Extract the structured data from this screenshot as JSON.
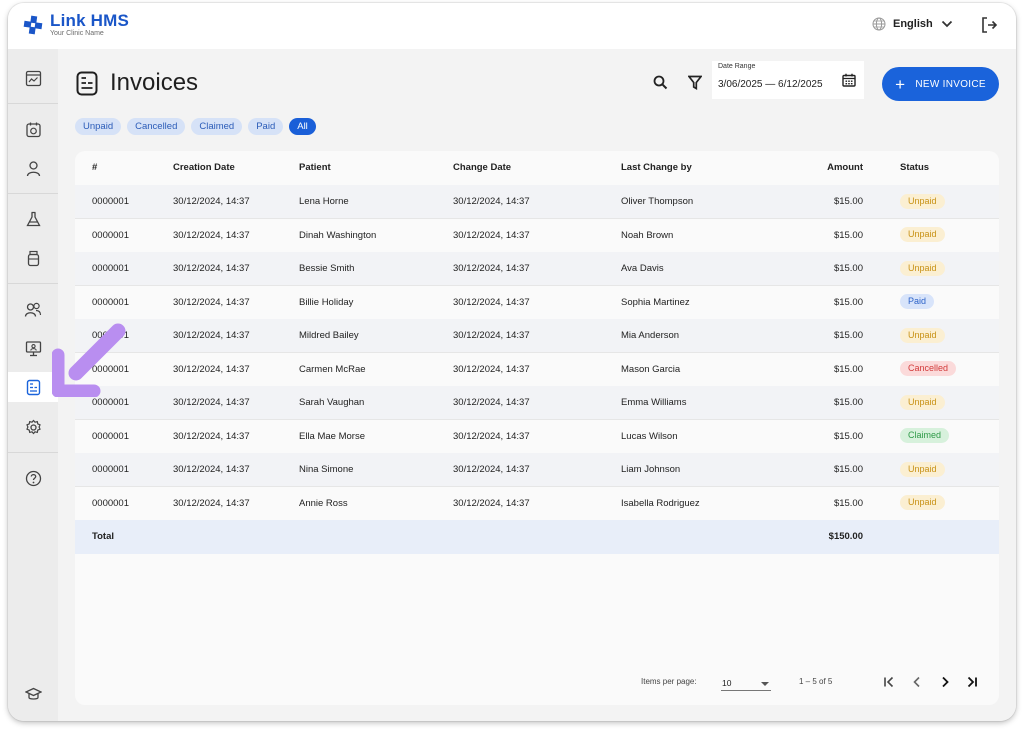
{
  "app": {
    "name": "Link HMS",
    "subtitle": "Your Clinic Name",
    "brand_color": "#1a56c8"
  },
  "header": {
    "language": "English",
    "language_icon": "globe-icon",
    "logout_icon": "logout-icon"
  },
  "sidebar": {
    "items": [
      {
        "icon": "dashboard-icon",
        "active": false
      },
      {
        "icon": "appointments-icon",
        "active": false
      },
      {
        "icon": "patients-icon",
        "active": false
      },
      {
        "icon": "lab-icon",
        "active": false
      },
      {
        "icon": "medication-icon",
        "active": false
      },
      {
        "icon": "staff-icon",
        "active": false
      },
      {
        "icon": "monitor-icon",
        "active": false
      },
      {
        "icon": "invoices-icon",
        "active": true
      },
      {
        "icon": "settings-icon",
        "active": false
      },
      {
        "icon": "help-icon",
        "active": false
      },
      {
        "icon": "education-icon",
        "active": false
      }
    ]
  },
  "page": {
    "title": "Invoices",
    "date_range_label": "Date Range",
    "date_range_value": "3/06/2025 — 6/12/2025",
    "new_button": "NEW INVOICE"
  },
  "filters": [
    {
      "label": "Unpaid",
      "active": false
    },
    {
      "label": "Cancelled",
      "active": false
    },
    {
      "label": "Claimed",
      "active": false
    },
    {
      "label": "Paid",
      "active": false
    },
    {
      "label": "All",
      "active": true
    }
  ],
  "table": {
    "columns": [
      "#",
      "Creation Date",
      "Patient",
      "Change Date",
      "Last Change by",
      "Amount",
      "Status"
    ],
    "rows": [
      {
        "id": "0000001",
        "created": "30/12/2024, 14:37",
        "patient": "Lena Horne",
        "changed": "30/12/2024, 14:37",
        "by": "Oliver Thompson",
        "amount": "$15.00",
        "status": "Unpaid"
      },
      {
        "id": "0000001",
        "created": "30/12/2024, 14:37",
        "patient": "Dinah Washington",
        "changed": "30/12/2024, 14:37",
        "by": "Noah Brown",
        "amount": "$15.00",
        "status": "Unpaid"
      },
      {
        "id": "0000001",
        "created": "30/12/2024, 14:37",
        "patient": "Bessie Smith",
        "changed": "30/12/2024, 14:37",
        "by": "Ava Davis",
        "amount": "$15.00",
        "status": "Unpaid"
      },
      {
        "id": "0000001",
        "created": "30/12/2024, 14:37",
        "patient": "Billie Holiday",
        "changed": "30/12/2024, 14:37",
        "by": "Sophia Martinez",
        "amount": "$15.00",
        "status": "Paid"
      },
      {
        "id": "0000001",
        "created": "30/12/2024, 14:37",
        "patient": "Mildred Bailey",
        "changed": "30/12/2024, 14:37",
        "by": "Mia Anderson",
        "amount": "$15.00",
        "status": "Unpaid"
      },
      {
        "id": "0000001",
        "created": "30/12/2024, 14:37",
        "patient": "Carmen McRae",
        "changed": "30/12/2024, 14:37",
        "by": "Mason Garcia",
        "amount": "$15.00",
        "status": "Cancelled"
      },
      {
        "id": "0000001",
        "created": "30/12/2024, 14:37",
        "patient": "Sarah Vaughan",
        "changed": "30/12/2024, 14:37",
        "by": "Emma Williams",
        "amount": "$15.00",
        "status": "Unpaid"
      },
      {
        "id": "0000001",
        "created": "30/12/2024, 14:37",
        "patient": "Ella Mae Morse",
        "changed": "30/12/2024, 14:37",
        "by": "Lucas Wilson",
        "amount": "$15.00",
        "status": "Claimed"
      },
      {
        "id": "0000001",
        "created": "30/12/2024, 14:37",
        "patient": "Nina Simone",
        "changed": "30/12/2024, 14:37",
        "by": "Liam Johnson",
        "amount": "$15.00",
        "status": "Unpaid"
      },
      {
        "id": "0000001",
        "created": "30/12/2024, 14:37",
        "patient": "Annie Ross",
        "changed": "30/12/2024, 14:37",
        "by": "Isabella Rodriguez",
        "amount": "$15.00",
        "status": "Unpaid"
      }
    ],
    "total_label": "Total",
    "total_amount": "$150.00"
  },
  "pagination": {
    "items_per_page_label": "Items per page:",
    "items_per_page": "10",
    "range": "1 – 5 of 5"
  },
  "colors": {
    "primary": "#1a63db",
    "unpaid": "#c89216",
    "paid": "#2d63c8",
    "cancelled": "#d23b3b",
    "claimed": "#2f9a48",
    "pointer": "#b98ef0"
  }
}
